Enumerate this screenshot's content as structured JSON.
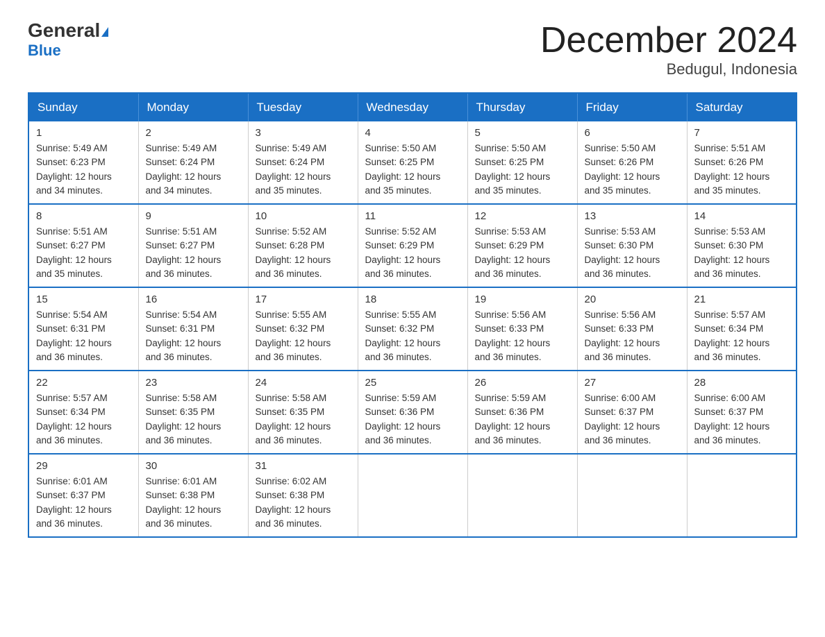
{
  "logo": {
    "general": "General",
    "blue": "Blue"
  },
  "title": "December 2024",
  "location": "Bedugul, Indonesia",
  "headers": [
    "Sunday",
    "Monday",
    "Tuesday",
    "Wednesday",
    "Thursday",
    "Friday",
    "Saturday"
  ],
  "weeks": [
    [
      {
        "day": "1",
        "sunrise": "5:49 AM",
        "sunset": "6:23 PM",
        "daylight": "12 hours and 34 minutes."
      },
      {
        "day": "2",
        "sunrise": "5:49 AM",
        "sunset": "6:24 PM",
        "daylight": "12 hours and 34 minutes."
      },
      {
        "day": "3",
        "sunrise": "5:49 AM",
        "sunset": "6:24 PM",
        "daylight": "12 hours and 35 minutes."
      },
      {
        "day": "4",
        "sunrise": "5:50 AM",
        "sunset": "6:25 PM",
        "daylight": "12 hours and 35 minutes."
      },
      {
        "day": "5",
        "sunrise": "5:50 AM",
        "sunset": "6:25 PM",
        "daylight": "12 hours and 35 minutes."
      },
      {
        "day": "6",
        "sunrise": "5:50 AM",
        "sunset": "6:26 PM",
        "daylight": "12 hours and 35 minutes."
      },
      {
        "day": "7",
        "sunrise": "5:51 AM",
        "sunset": "6:26 PM",
        "daylight": "12 hours and 35 minutes."
      }
    ],
    [
      {
        "day": "8",
        "sunrise": "5:51 AM",
        "sunset": "6:27 PM",
        "daylight": "12 hours and 35 minutes."
      },
      {
        "day": "9",
        "sunrise": "5:51 AM",
        "sunset": "6:27 PM",
        "daylight": "12 hours and 36 minutes."
      },
      {
        "day": "10",
        "sunrise": "5:52 AM",
        "sunset": "6:28 PM",
        "daylight": "12 hours and 36 minutes."
      },
      {
        "day": "11",
        "sunrise": "5:52 AM",
        "sunset": "6:29 PM",
        "daylight": "12 hours and 36 minutes."
      },
      {
        "day": "12",
        "sunrise": "5:53 AM",
        "sunset": "6:29 PM",
        "daylight": "12 hours and 36 minutes."
      },
      {
        "day": "13",
        "sunrise": "5:53 AM",
        "sunset": "6:30 PM",
        "daylight": "12 hours and 36 minutes."
      },
      {
        "day": "14",
        "sunrise": "5:53 AM",
        "sunset": "6:30 PM",
        "daylight": "12 hours and 36 minutes."
      }
    ],
    [
      {
        "day": "15",
        "sunrise": "5:54 AM",
        "sunset": "6:31 PM",
        "daylight": "12 hours and 36 minutes."
      },
      {
        "day": "16",
        "sunrise": "5:54 AM",
        "sunset": "6:31 PM",
        "daylight": "12 hours and 36 minutes."
      },
      {
        "day": "17",
        "sunrise": "5:55 AM",
        "sunset": "6:32 PM",
        "daylight": "12 hours and 36 minutes."
      },
      {
        "day": "18",
        "sunrise": "5:55 AM",
        "sunset": "6:32 PM",
        "daylight": "12 hours and 36 minutes."
      },
      {
        "day": "19",
        "sunrise": "5:56 AM",
        "sunset": "6:33 PM",
        "daylight": "12 hours and 36 minutes."
      },
      {
        "day": "20",
        "sunrise": "5:56 AM",
        "sunset": "6:33 PM",
        "daylight": "12 hours and 36 minutes."
      },
      {
        "day": "21",
        "sunrise": "5:57 AM",
        "sunset": "6:34 PM",
        "daylight": "12 hours and 36 minutes."
      }
    ],
    [
      {
        "day": "22",
        "sunrise": "5:57 AM",
        "sunset": "6:34 PM",
        "daylight": "12 hours and 36 minutes."
      },
      {
        "day": "23",
        "sunrise": "5:58 AM",
        "sunset": "6:35 PM",
        "daylight": "12 hours and 36 minutes."
      },
      {
        "day": "24",
        "sunrise": "5:58 AM",
        "sunset": "6:35 PM",
        "daylight": "12 hours and 36 minutes."
      },
      {
        "day": "25",
        "sunrise": "5:59 AM",
        "sunset": "6:36 PM",
        "daylight": "12 hours and 36 minutes."
      },
      {
        "day": "26",
        "sunrise": "5:59 AM",
        "sunset": "6:36 PM",
        "daylight": "12 hours and 36 minutes."
      },
      {
        "day": "27",
        "sunrise": "6:00 AM",
        "sunset": "6:37 PM",
        "daylight": "12 hours and 36 minutes."
      },
      {
        "day": "28",
        "sunrise": "6:00 AM",
        "sunset": "6:37 PM",
        "daylight": "12 hours and 36 minutes."
      }
    ],
    [
      {
        "day": "29",
        "sunrise": "6:01 AM",
        "sunset": "6:37 PM",
        "daylight": "12 hours and 36 minutes."
      },
      {
        "day": "30",
        "sunrise": "6:01 AM",
        "sunset": "6:38 PM",
        "daylight": "12 hours and 36 minutes."
      },
      {
        "day": "31",
        "sunrise": "6:02 AM",
        "sunset": "6:38 PM",
        "daylight": "12 hours and 36 minutes."
      },
      null,
      null,
      null,
      null
    ]
  ],
  "labels": {
    "sunrise": "Sunrise:",
    "sunset": "Sunset:",
    "daylight": "Daylight:"
  }
}
